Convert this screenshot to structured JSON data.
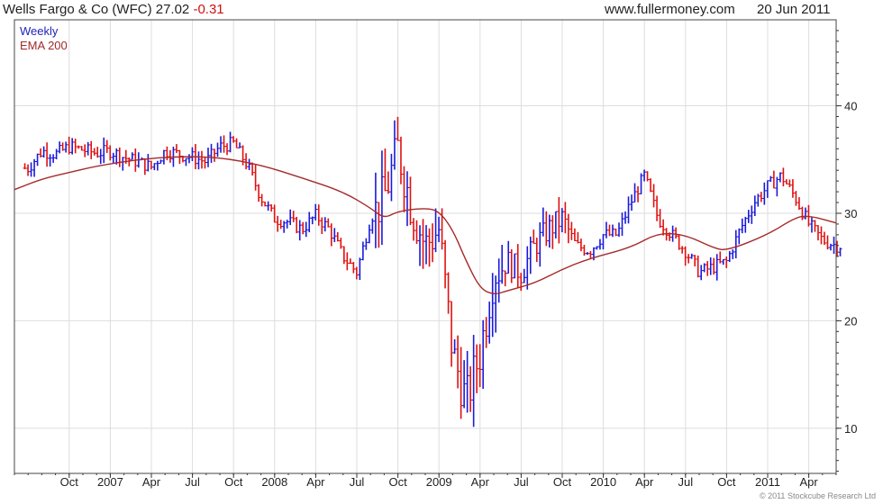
{
  "header": {
    "title": "Wells Fargo & Co (WFC) 27.02",
    "change": "-0.31",
    "website": "www.fullermoney.com",
    "date": "20 Jun 2011"
  },
  "legend": {
    "weekly": "Weekly",
    "ema": "EMA 200"
  },
  "footer": {
    "credit": "© 2011 Stockcube Research Ltd"
  },
  "colors": {
    "up": "#1a1adb",
    "down": "#e01010",
    "ema": "#a52a2a",
    "grid": "#dddddd"
  },
  "chart_data": {
    "type": "line",
    "title": "Wells Fargo & Co (WFC) 27.02 -0.31",
    "xlabel": "",
    "ylabel": "",
    "ylim": [
      5.8,
      48
    ],
    "y_ticks": [
      10,
      20,
      30,
      40
    ],
    "y_axis_side": "right",
    "x_ticks": [
      "Oct",
      "2007",
      "Apr",
      "Jul",
      "Oct",
      "2008",
      "Apr",
      "Jul",
      "Oct",
      "2009",
      "Apr",
      "Jul",
      "Oct",
      "2010",
      "Apr",
      "Jul",
      "Oct",
      "2011",
      "Apr"
    ],
    "x_range": [
      "2006-06",
      "2011-06"
    ],
    "grid": true,
    "legend_placement": "top-left",
    "series": [
      {
        "name": "Weekly",
        "kind": "price",
        "points": [
          [
            "2006-07",
            34.2
          ],
          [
            "2006-08",
            35.8
          ],
          [
            "2006-09",
            35.5
          ],
          [
            "2006-10",
            36.2
          ],
          [
            "2006-11",
            35.9
          ],
          [
            "2006-12",
            35.6
          ],
          [
            "2007-01",
            35.8
          ],
          [
            "2007-02",
            35.2
          ],
          [
            "2007-03",
            34.8
          ],
          [
            "2007-04",
            34.3
          ],
          [
            "2007-05",
            35.8
          ],
          [
            "2007-06",
            35.5
          ],
          [
            "2007-07",
            35.2
          ],
          [
            "2007-08",
            34.8
          ],
          [
            "2007-09",
            36.2
          ],
          [
            "2007-10",
            36.5
          ],
          [
            "2007-11",
            34.5
          ],
          [
            "2007-12",
            31.5
          ],
          [
            "2008-01",
            29.5
          ],
          [
            "2008-02",
            29.2
          ],
          [
            "2008-03",
            28.5
          ],
          [
            "2008-04",
            29.8
          ],
          [
            "2008-05",
            28.5
          ],
          [
            "2008-06",
            26.0
          ],
          [
            "2008-07",
            24.5
          ],
          [
            "2008-08",
            29.5
          ],
          [
            "2008-09",
            31.5
          ],
          [
            "2008-10",
            36.0
          ],
          [
            "2008-11",
            30.5
          ],
          [
            "2008-12",
            27.0
          ],
          [
            "2009-01",
            28.5
          ],
          [
            "2009-02",
            17.0
          ],
          [
            "2009-03",
            12.5
          ],
          [
            "2009-04",
            17.0
          ],
          [
            "2009-05",
            24.5
          ],
          [
            "2009-06",
            25.5
          ],
          [
            "2009-07",
            24.5
          ],
          [
            "2009-08",
            27.0
          ],
          [
            "2009-09",
            28.5
          ],
          [
            "2009-10",
            29.5
          ],
          [
            "2009-11",
            27.0
          ],
          [
            "2009-12",
            26.5
          ],
          [
            "2010-01",
            28.0
          ],
          [
            "2010-02",
            28.0
          ],
          [
            "2010-03",
            31.0
          ],
          [
            "2010-04",
            33.5
          ],
          [
            "2010-05",
            29.5
          ],
          [
            "2010-06",
            28.0
          ],
          [
            "2010-07",
            26.5
          ],
          [
            "2010-08",
            24.5
          ],
          [
            "2010-09",
            25.0
          ],
          [
            "2010-10",
            25.5
          ],
          [
            "2010-11",
            28.5
          ],
          [
            "2010-12",
            31.0
          ],
          [
            "2011-01",
            32.5
          ],
          [
            "2011-02",
            33.5
          ],
          [
            "2011-03",
            31.5
          ],
          [
            "2011-04",
            29.0
          ],
          [
            "2011-05",
            27.5
          ],
          [
            "2011-06",
            27.0
          ]
        ]
      },
      {
        "name": "EMA 200",
        "kind": "line",
        "points": [
          [
            "2006-06",
            32.2
          ],
          [
            "2006-08",
            33.2
          ],
          [
            "2006-10",
            33.8
          ],
          [
            "2006-12",
            34.4
          ],
          [
            "2007-03",
            35.0
          ],
          [
            "2007-06",
            35.3
          ],
          [
            "2007-09",
            35.2
          ],
          [
            "2007-12",
            34.5
          ],
          [
            "2008-03",
            33.3
          ],
          [
            "2008-06",
            32.0
          ],
          [
            "2008-08",
            30.5
          ],
          [
            "2008-09",
            29.5
          ],
          [
            "2008-10",
            30.2
          ],
          [
            "2008-12",
            30.5
          ],
          [
            "2009-01",
            30.2
          ],
          [
            "2009-02",
            28.5
          ],
          [
            "2009-03",
            25.5
          ],
          [
            "2009-04",
            23.0
          ],
          [
            "2009-05",
            22.4
          ],
          [
            "2009-06",
            22.8
          ],
          [
            "2009-08",
            23.5
          ],
          [
            "2009-10",
            24.8
          ],
          [
            "2009-12",
            25.8
          ],
          [
            "2010-03",
            26.8
          ],
          [
            "2010-05",
            28.2
          ],
          [
            "2010-07",
            28.0
          ],
          [
            "2010-09",
            26.8
          ],
          [
            "2010-10",
            26.5
          ],
          [
            "2011-01",
            28.0
          ],
          [
            "2011-03",
            29.6
          ],
          [
            "2011-04",
            29.8
          ],
          [
            "2011-06",
            29.1
          ]
        ]
      }
    ]
  }
}
